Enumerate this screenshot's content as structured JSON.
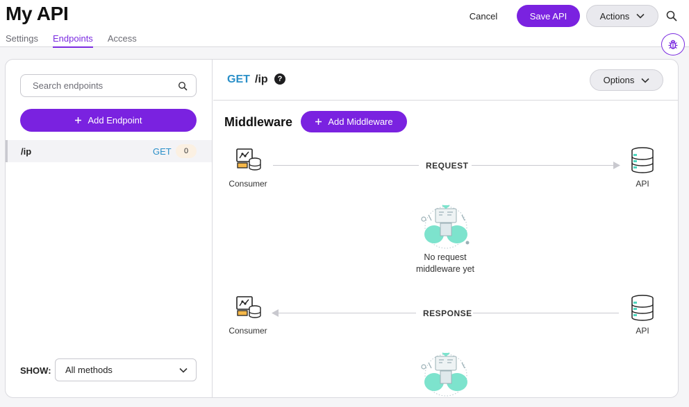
{
  "header": {
    "title": "My API",
    "tabs": [
      {
        "label": "Settings",
        "active": false
      },
      {
        "label": "Endpoints",
        "active": true
      },
      {
        "label": "Access",
        "active": false
      }
    ],
    "cancel_label": "Cancel",
    "save_label": "Save API",
    "actions_label": "Actions"
  },
  "sidebar": {
    "search_placeholder": "Search endpoints",
    "add_endpoint_label": "Add Endpoint",
    "endpoints": [
      {
        "path": "/ip",
        "method": "GET",
        "count": "0"
      }
    ],
    "show_label": "SHOW:",
    "method_filter": "All methods"
  },
  "main": {
    "method": "GET",
    "path": "/ip",
    "help_glyph": "?",
    "options_label": "Options",
    "middleware_title": "Middleware",
    "add_middleware_label": "Add Middleware",
    "request": {
      "from_label": "Consumer",
      "flow_label": "REQUEST",
      "to_label": "API",
      "empty_line1": "No request",
      "empty_line2": "middleware yet"
    },
    "response": {
      "from_label": "Consumer",
      "flow_label": "RESPONSE",
      "to_label": "API"
    }
  },
  "colors": {
    "accent": "#7a22e0",
    "method_get": "#2a8fc8",
    "illustration": "#7de3cd"
  },
  "icons": [
    "search-icon",
    "chevron-down-icon",
    "plus-icon",
    "bug-icon",
    "help-icon",
    "consumer-icon",
    "database-icon",
    "arrow-right-icon",
    "arrow-left-icon"
  ]
}
